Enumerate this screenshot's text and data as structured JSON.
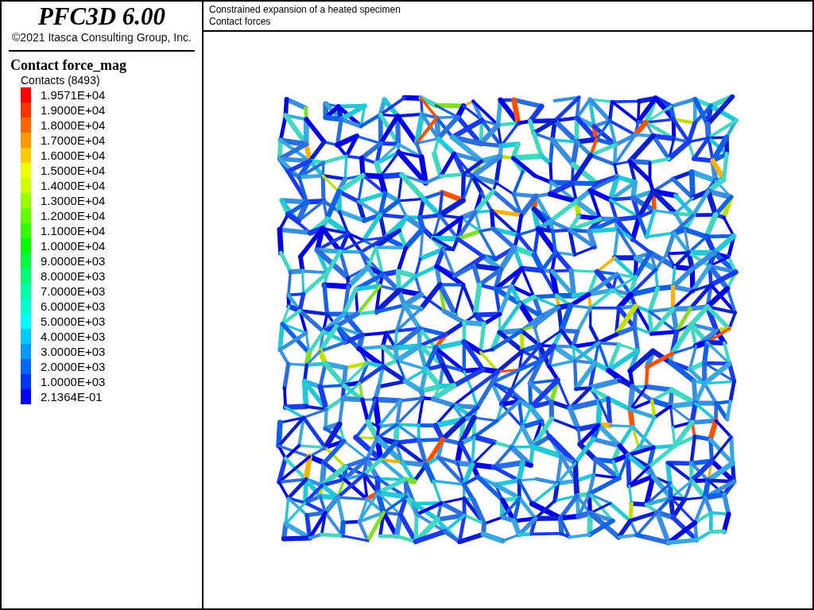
{
  "header": {
    "logo": "PFC3D 6.00",
    "copyright": "©2021 Itasca Consulting Group, Inc."
  },
  "legend": {
    "title": "Contact force_mag",
    "subtitle": "Contacts (8493)",
    "items": [
      {
        "label": "1.9571E+04",
        "color": "#ff0000"
      },
      {
        "label": "1.9000E+04",
        "color": "#ff3300"
      },
      {
        "label": "1.8000E+04",
        "color": "#ff6600"
      },
      {
        "label": "1.7000E+04",
        "color": "#ff9900"
      },
      {
        "label": "1.6000E+04",
        "color": "#ffcc00"
      },
      {
        "label": "1.5000E+04",
        "color": "#eeff00"
      },
      {
        "label": "1.4000E+04",
        "color": "#ccff00"
      },
      {
        "label": "1.3000E+04",
        "color": "#99ff00"
      },
      {
        "label": "1.2000E+04",
        "color": "#66ff00"
      },
      {
        "label": "1.1000E+04",
        "color": "#33ff00"
      },
      {
        "label": "1.0000E+04",
        "color": "#00ff00"
      },
      {
        "label": "9.0000E+03",
        "color": "#00ff44"
      },
      {
        "label": "8.0000E+03",
        "color": "#00ff77"
      },
      {
        "label": "7.0000E+03",
        "color": "#00ffaa"
      },
      {
        "label": "6.0000E+03",
        "color": "#00ffcc"
      },
      {
        "label": "5.0000E+03",
        "color": "#00ffff"
      },
      {
        "label": "4.0000E+03",
        "color": "#00ccff"
      },
      {
        "label": "3.0000E+03",
        "color": "#0099ff"
      },
      {
        "label": "2.0000E+03",
        "color": "#0066ff"
      },
      {
        "label": "1.0000E+03",
        "color": "#0033ff"
      },
      {
        "label": "2.1364E-01",
        "color": "#0000ff"
      }
    ]
  },
  "plot": {
    "title_lines": [
      "Constrained expansion of a heated specimen",
      "Contact forces"
    ]
  }
}
